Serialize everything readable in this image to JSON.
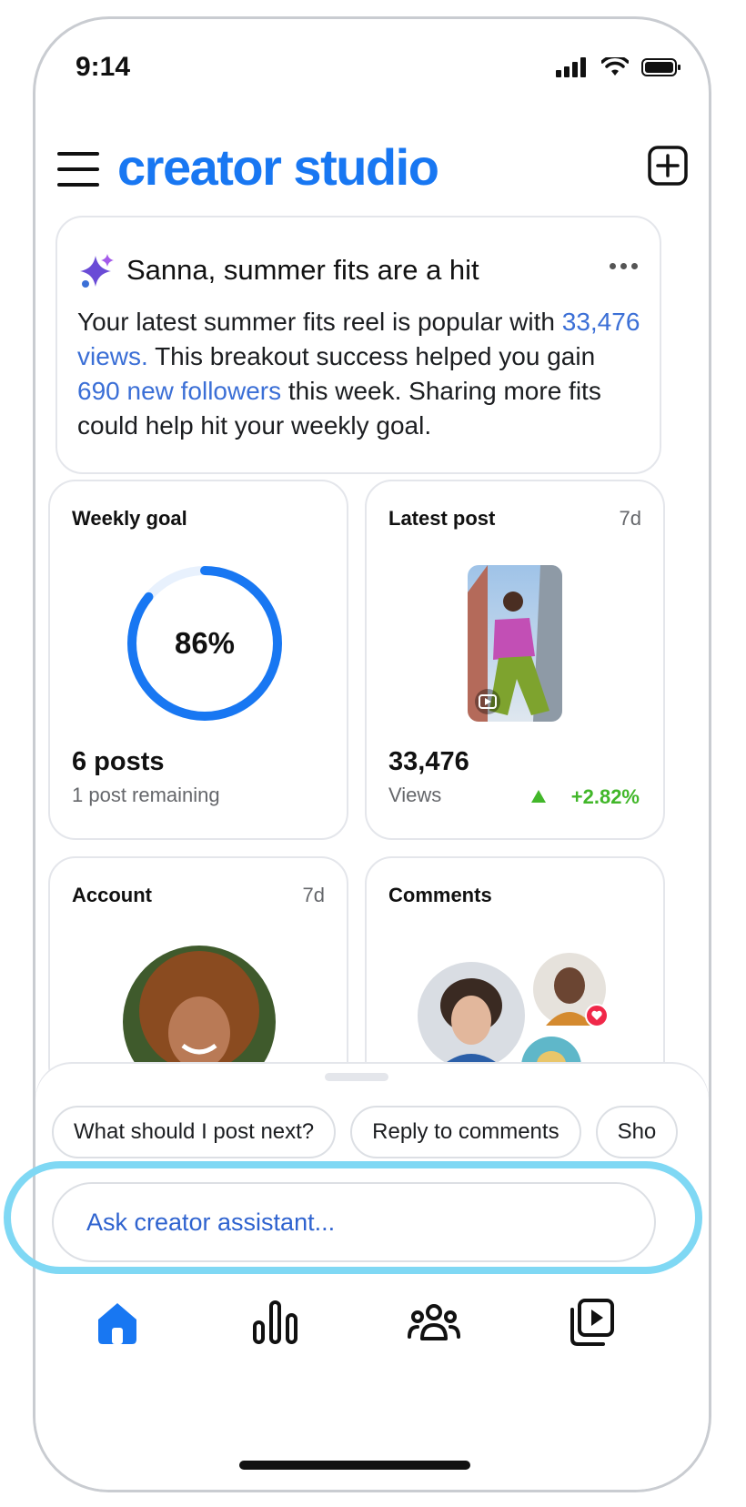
{
  "status_bar": {
    "time": "9:14"
  },
  "app": {
    "brand": "creator studio"
  },
  "insight": {
    "title": "Sanna, summer fits are a hit",
    "body_1": "Your latest summer fits reel is popular with ",
    "views_link": "33,476 views.",
    "body_2": " This breakout success helped you gain ",
    "followers_link": "690 new followers",
    "body_3": " this week. Sharing more fits could help hit your weekly goal."
  },
  "weekly_goal": {
    "title": "Weekly goal",
    "percent_label": "86%",
    "progress": 0.86,
    "posts": "6 posts",
    "remaining": "1 post remaining"
  },
  "latest_post": {
    "title": "Latest post",
    "age": "7d",
    "views_value": "33,476",
    "views_label": "Views",
    "trend": "+2.82%"
  },
  "account": {
    "title": "Account",
    "age": "7d"
  },
  "comments": {
    "title": "Comments"
  },
  "assistant": {
    "chips": [
      "What should I post next?",
      "Reply to comments",
      "Sho"
    ],
    "input_placeholder": "Ask creator assistant..."
  },
  "nav": [
    "home-icon",
    "insights-icon",
    "community-icon",
    "content-library-icon"
  ],
  "colors": {
    "brand": "#1877f2",
    "link": "#3b6fd6",
    "positive": "#42b72a",
    "highlight": "#7fd8f4"
  }
}
